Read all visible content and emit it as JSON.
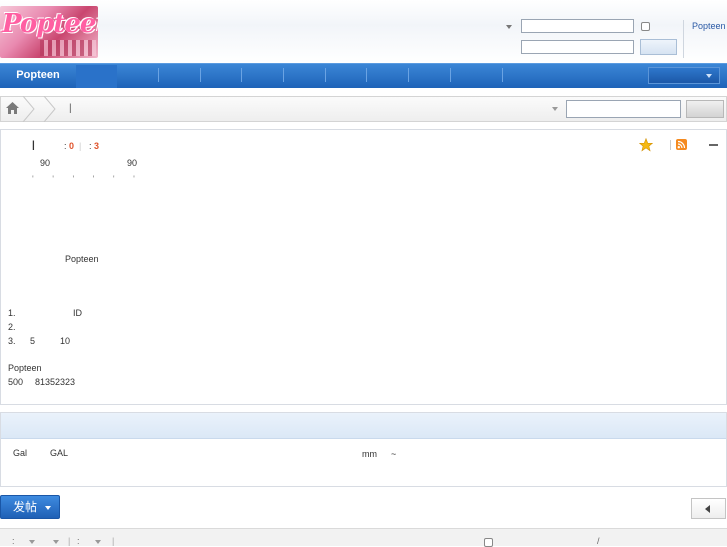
{
  "header": {
    "logo_alt": "Popteen",
    "site_link": "Popteen"
  },
  "nav": {
    "home_label": "Popteen"
  },
  "breadcrumb": {
    "separator": "|"
  },
  "forum": {
    "title_marker": "|",
    "today_label": ":",
    "today_count": "0",
    "divider": "|",
    "total_label": ":",
    "total_count": "3",
    "stat_left": "90",
    "stat_right": "90",
    "moderators": "' ' ' ' ' '",
    "rules_title": "Popteen",
    "rules": [
      "1.",
      "ID",
      "2.",
      "3.",
      "5",
      "10"
    ],
    "footer_name": "Popteen",
    "footer_line": "500",
    "footer_number": "81352323"
  },
  "threads": {
    "col1": "Gal",
    "col2": "GAL",
    "col3": "mm",
    "col4": "~"
  },
  "actions": {
    "post_label": "发帖"
  },
  "filter": {
    "sep1": ":",
    "sep2": "|",
    "sep3": ":",
    "sep4": "|",
    "slash": "/"
  }
}
